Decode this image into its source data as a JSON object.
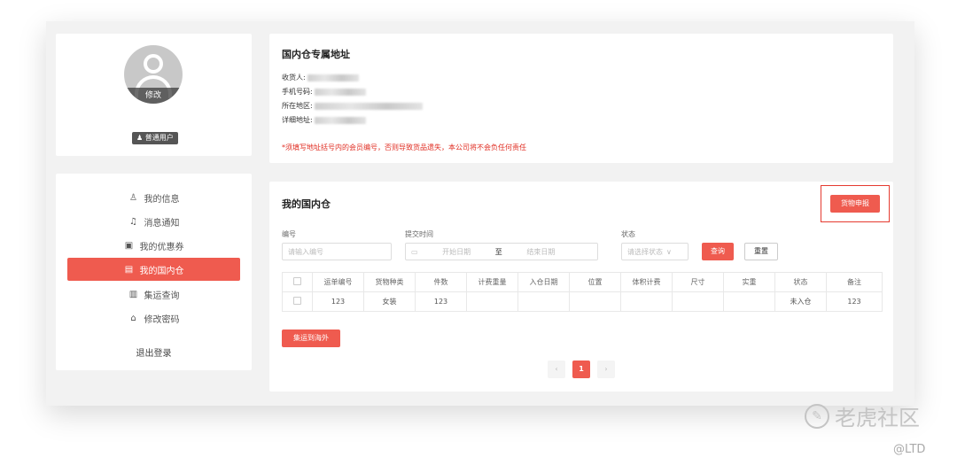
{
  "profile": {
    "avatar_edit": "修改",
    "badge": "普通用户"
  },
  "menu": {
    "items": [
      {
        "icon": "user-icon",
        "glyph": "♙",
        "label": "我的信息",
        "active": false
      },
      {
        "icon": "bell-icon",
        "glyph": "♫",
        "label": "消息通知",
        "active": false
      },
      {
        "icon": "coupon-icon",
        "glyph": "▣",
        "label": "我的优惠券",
        "active": false
      },
      {
        "icon": "warehouse-icon",
        "glyph": "▤",
        "label": "我的国内仓",
        "active": true
      },
      {
        "icon": "shipping-icon",
        "glyph": "▥",
        "label": "集运查询",
        "active": false
      },
      {
        "icon": "lock-icon",
        "glyph": "⌂",
        "label": "修改密码",
        "active": false
      }
    ],
    "logout": "退出登录"
  },
  "address": {
    "title": "国内仓专属地址",
    "receiver_label": "收货人:",
    "phone_label": "手机号码:",
    "region_label": "所在地区:",
    "detail_label": "详细地址:",
    "warning": "*须填写地址括号内的会员编号，否则导致货品遗失，本公司将不会负任何责任"
  },
  "warehouse": {
    "title": "我的国内仓",
    "declare_button": "货物申报",
    "filters": {
      "id_label": "编号",
      "id_placeholder": "请输入编号",
      "time_label": "提交时间",
      "start_placeholder": "开始日期",
      "range_sep": "至",
      "end_placeholder": "结束日期",
      "status_label": "状态",
      "status_placeholder": "请选择状态",
      "query_button": "查询",
      "reset_button": "重置"
    },
    "table": {
      "columns": [
        "运单编号",
        "货物种类",
        "件数",
        "计费重量",
        "入仓日期",
        "位置",
        "体积计费",
        "尺寸",
        "实重",
        "状态",
        "备注"
      ],
      "rows": [
        [
          "123",
          "女装",
          "123",
          "",
          "",
          "",
          "",
          "",
          "",
          "未入仓",
          "123"
        ]
      ]
    },
    "transfer_button": "集运到海外",
    "pagination": {
      "prev": "‹",
      "current": "1",
      "next": "›"
    }
  },
  "watermark": {
    "text": "老虎社区",
    "sub": "@LTD"
  },
  "colors": {
    "accent": "#ef5b4f",
    "warning": "#e02d22",
    "highlight_border": "#e53b30"
  }
}
